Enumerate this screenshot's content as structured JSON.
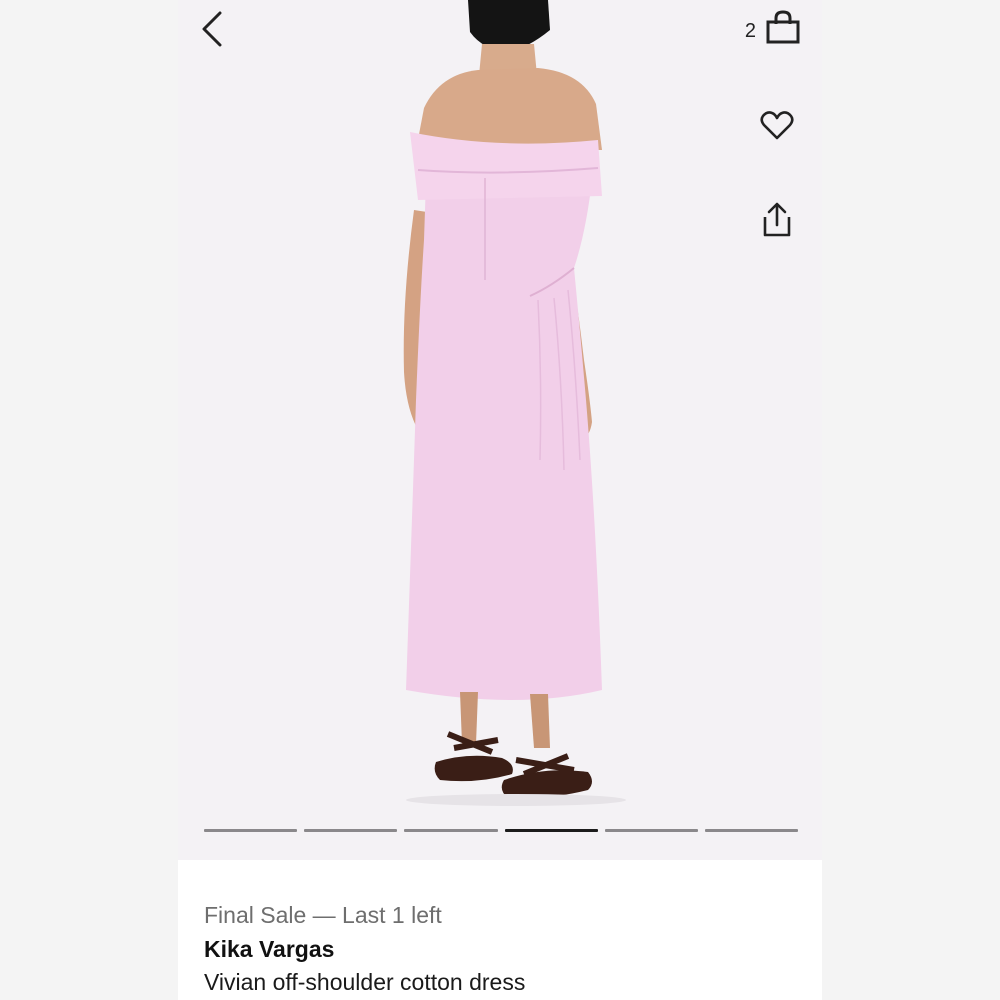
{
  "header": {
    "back_icon": "chevron-left-icon",
    "bag_icon": "shopping-bag-icon",
    "bag_count": "2",
    "favorite_icon": "heart-icon",
    "share_icon": "share-icon"
  },
  "gallery": {
    "image_count": 6,
    "active_index": 3
  },
  "product": {
    "status": "Final Sale — Last 1 left",
    "brand": "Kika Vargas",
    "name": "Vivian off-shoulder cotton dress"
  },
  "colors": {
    "dress": "#f2cfe9",
    "background": "#f4f2f5",
    "active_indicator": "#1c1c1c",
    "inactive_indicator": "#8a888b"
  }
}
